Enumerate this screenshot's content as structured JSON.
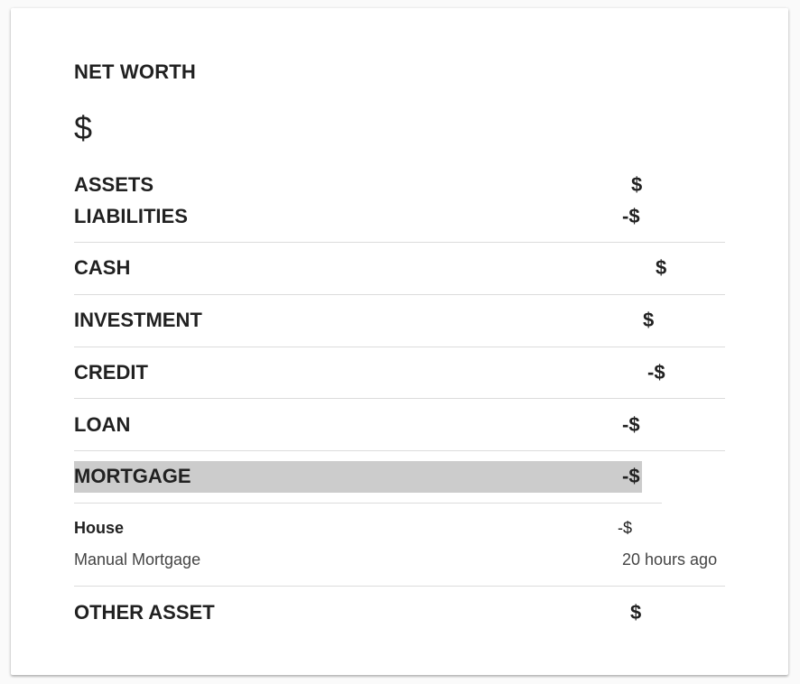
{
  "net_worth": {
    "title": "NET WORTH",
    "value": "$"
  },
  "summary": {
    "assets_label": "ASSETS",
    "assets_value": "$",
    "liabilities_label": "LIABILITIES",
    "liabilities_value": "-$"
  },
  "categories": [
    {
      "label": "CASH",
      "value": "$"
    },
    {
      "label": "INVESTMENT",
      "value": "$"
    },
    {
      "label": "CREDIT",
      "value": "-$"
    },
    {
      "label": "LOAN",
      "value": "-$"
    },
    {
      "label": "MORTGAGE",
      "value": "-$"
    },
    {
      "label": "OTHER ASSET",
      "value": "$"
    }
  ],
  "mortgage_accounts": [
    {
      "name": "House",
      "value": "-$",
      "type": "Manual Mortgage",
      "updated": "20 hours ago"
    }
  ],
  "colors": {
    "highlight": "#cccccc",
    "divider": "#dcdcdc",
    "text": "#212121"
  }
}
